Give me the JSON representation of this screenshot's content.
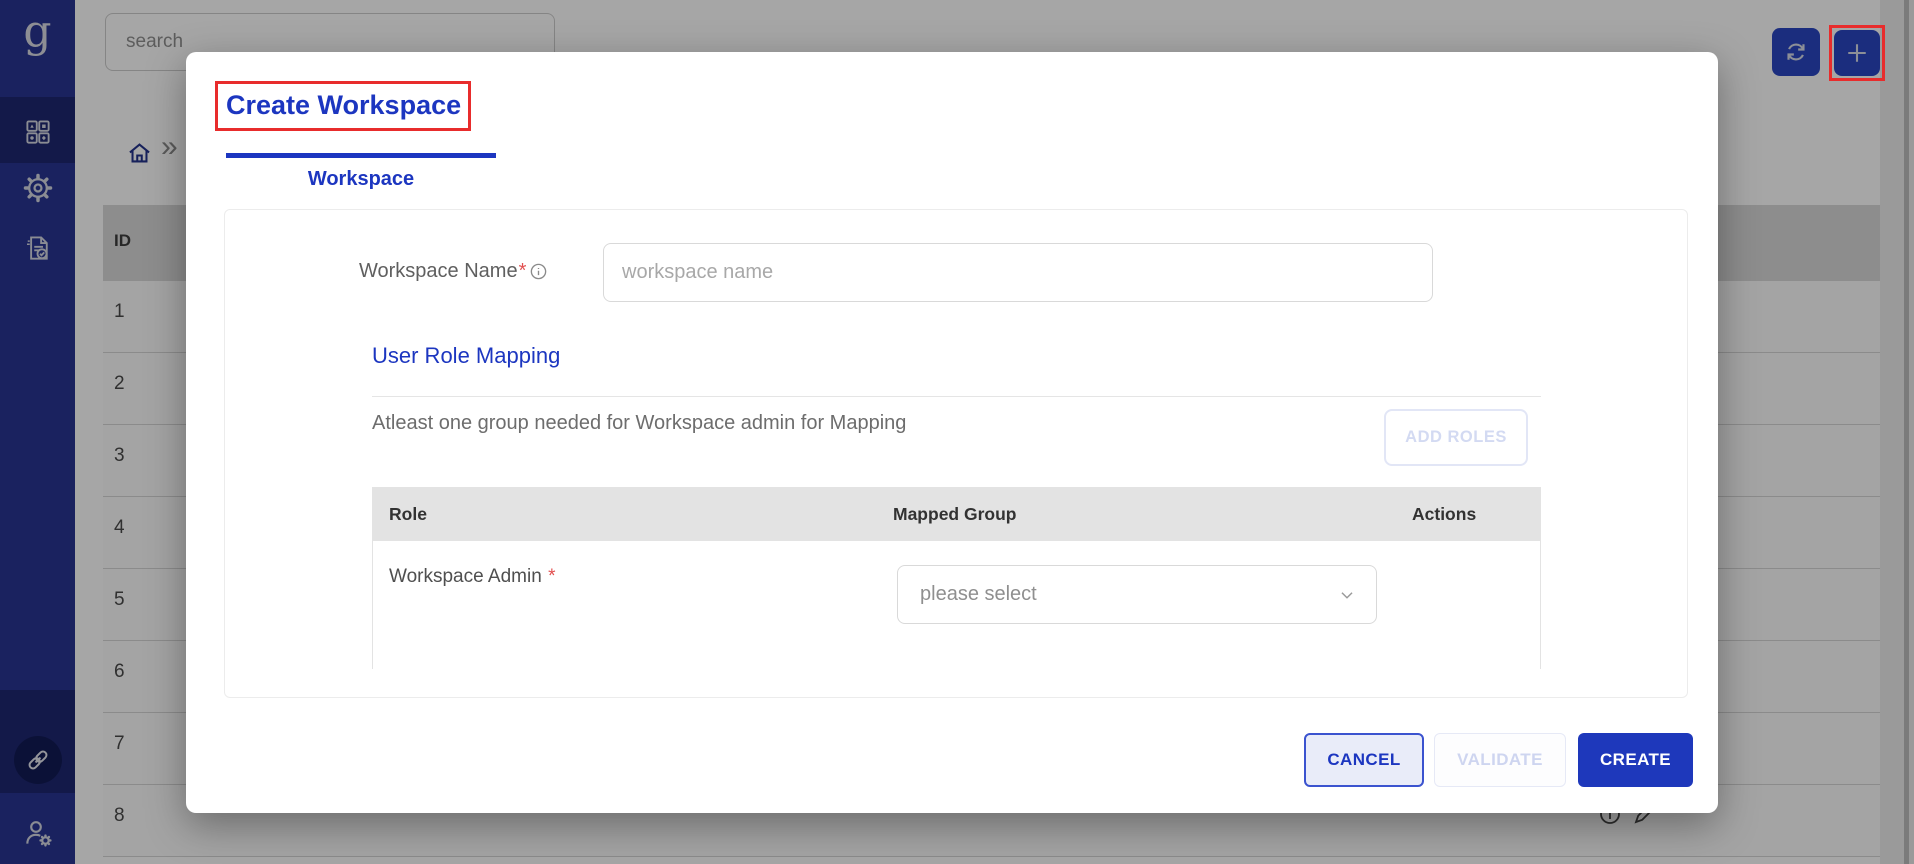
{
  "colors": {
    "brand_blue": "#1c36c0",
    "sidebar_blue": "#283593",
    "annotation_red": "#e82c2c",
    "table_header_gray": "#d9d9d9"
  },
  "sidebar": {
    "logo_text": "g",
    "icons": [
      "dashboard-grid",
      "settings-gear",
      "audit-document",
      "link-chain",
      "user-settings"
    ]
  },
  "topbar": {
    "search_placeholder": "search",
    "icons": [
      "refresh",
      "plus"
    ]
  },
  "breadcrumb": {
    "home_icon": "home",
    "separator": "»"
  },
  "background_table": {
    "id_header": "ID",
    "rows": [
      "1",
      "2",
      "3",
      "4",
      "5",
      "6",
      "7",
      "8"
    ]
  },
  "modal": {
    "title": "Create Workspace",
    "tab_label": "Workspace",
    "workspace_name": {
      "label": "Workspace Name",
      "required_marker": "*",
      "placeholder": "workspace name"
    },
    "section": {
      "title": "User Role Mapping",
      "helper": "Atleast one group needed for Workspace admin for Mapping",
      "add_roles_label": "ADD ROLES"
    },
    "role_table": {
      "headers": [
        "Role",
        "Mapped Group",
        "Actions"
      ],
      "rows": [
        {
          "role": "Workspace Admin",
          "required_marker": "*",
          "mapped_group_placeholder": "please select"
        }
      ]
    },
    "footer": {
      "cancel": "CANCEL",
      "validate": "VALIDATE",
      "create": "CREATE"
    }
  }
}
